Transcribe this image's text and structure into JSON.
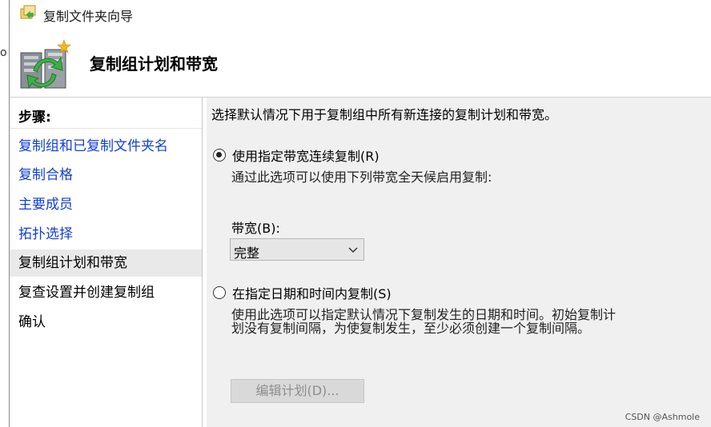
{
  "window": {
    "title": "复制文件夹向导",
    "left_fragment": "o"
  },
  "header": {
    "title": "复制组计划和带宽"
  },
  "sidebar": {
    "heading": "步骤:",
    "steps": [
      {
        "label": "复制组和已复制文件夹名",
        "state": "link"
      },
      {
        "label": "复制合格",
        "state": "link"
      },
      {
        "label": "主要成员",
        "state": "link"
      },
      {
        "label": "拓扑选择",
        "state": "link"
      },
      {
        "label": "复制组计划和带宽",
        "state": "current"
      },
      {
        "label": "复查设置并创建复制组",
        "state": "plain"
      },
      {
        "label": "确认",
        "state": "plain"
      }
    ]
  },
  "main": {
    "intro": "选择默认情况下用于复制组中所有新连接的复制计划和带宽。",
    "option_continuous": {
      "label": "使用指定带宽连续复制(R)",
      "checked": true,
      "description": "通过此选项可以使用下列带宽全天候启用复制:"
    },
    "bandwidth": {
      "label": "带宽(B):",
      "value": "完整"
    },
    "option_schedule": {
      "label": "在指定日期和时间内复制(S)",
      "checked": false,
      "description_line1": "使用此选项可以指定默认情况下复制发生的日期和时间。初始复制计",
      "description_line2": "划没有复制间隔，为使复制发生，至少必须创建一个复制间隔。"
    },
    "edit_schedule_button": "编辑计划(D)..."
  },
  "watermark": "CSDN @Ashmole",
  "colors": {
    "link": "#1040d8",
    "panel_bg": "#f0f0f0",
    "current_step_bg": "#e9e9e9"
  }
}
